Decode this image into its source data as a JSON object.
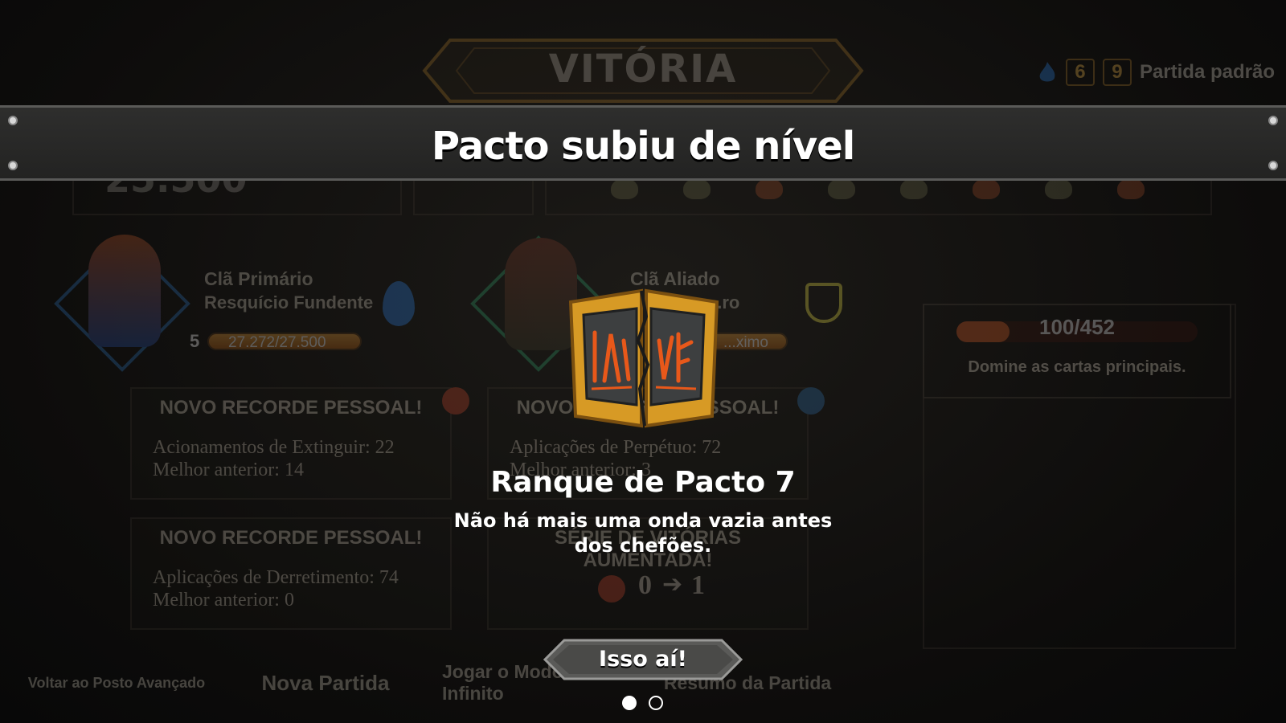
{
  "background": {
    "title": "VITÓRIA",
    "top_right": {
      "first_count": "6",
      "second_count": "9",
      "mode": "Partida padrão"
    },
    "score": "25.500",
    "primary_clan": {
      "label": "Clã Primário",
      "name": "Resquício Fundente",
      "level": "5",
      "xp": "27.272/27.500"
    },
    "allied_clan": {
      "label": "Clã Aliado",
      "name": "...ro",
      "status": "...ximo"
    },
    "records": [
      {
        "heading": "NOVO RECORDE PESSOAL!",
        "line1": "Acionamentos de Extinguir: 22",
        "line2": "Melhor anterior: 14"
      },
      {
        "heading": "NOVO RECORDE PESSOAL!",
        "line1": "Aplicações de Derretimento: 74",
        "line2": "Melhor anterior: 0"
      },
      {
        "heading": "NOVO RECORDE PESSOAL!",
        "line1": "Aplicações de Perpétuo: 72",
        "line2": "Melhor anterior: 3"
      },
      {
        "heading": "SÉRIE DE VITÓRIAS AUMENTADA!",
        "from": "0",
        "to": "1"
      }
    ],
    "challenge": {
      "count": "100/452",
      "progress": 0.221,
      "description": "Domine as cartas principais."
    },
    "nav": [
      "Voltar ao Posto Avançado",
      "Nova Partida",
      "Jogar o Modo Infinito",
      "Resumo da Partida"
    ]
  },
  "overlay": {
    "banner_title": "Pacto subiu de nível",
    "reward_title": "Ranque de Pacto 7",
    "reward_description": "Não há mais uma onda vazia antes dos chefões.",
    "confirm_button": "Isso aí!",
    "pages": {
      "total": 2,
      "current": 1
    }
  },
  "colors": {
    "banner": "#2e2e2d",
    "book_gold": "#d79a25",
    "button": "#5a5a58",
    "xp_orange": "#e39b3a"
  }
}
